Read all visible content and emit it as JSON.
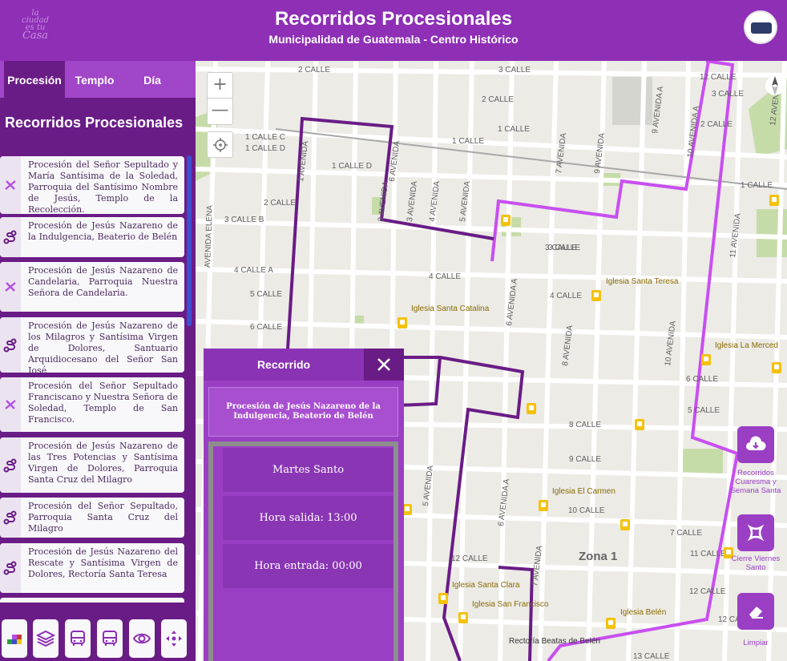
{
  "header": {
    "title": "Recorridos Procesionales",
    "subtitle": "Municipalidad de Guatemala - Centro Histórico",
    "logo_left_text": [
      "la",
      "ciudad",
      "es tu",
      "Casa"
    ]
  },
  "sidebar": {
    "tabs": [
      {
        "label": "Procesión",
        "active": true
      },
      {
        "label": "Templo",
        "active": false
      },
      {
        "label": "Día",
        "active": false
      }
    ],
    "title": "Recorridos Procesionales",
    "items": [
      {
        "icon": "no-route-icon",
        "label": "Procesión del Señor Sepultado y María Santísima de la Soledad, Parroquia del Santísimo Nombre de Jesús, Templo de la Recolección."
      },
      {
        "icon": "route-icon",
        "label": "Procesión de Jesús Nazareno de la Indulgencia, Beaterio de Belén"
      },
      {
        "icon": "no-route-icon",
        "label": "Procesión de Jesús Nazareno de Candelaria, Parroquia Nuestra Señora de Candelaria."
      },
      {
        "icon": "route-icon",
        "label": "Procesión de Jesús Nazareno de los Milagros y Santísima Virgen de Dolores, Santuario Arquidiocesano del Señor San José"
      },
      {
        "icon": "no-route-icon",
        "label": "Procesión del Señor Sepultado Franciscano y Nuestra Señora de Soledad, Templo de San Francisco."
      },
      {
        "icon": "route-icon",
        "label": "Procesión de Jesús Nazareno de las Tres Potencias y Santísima Virgen de Dolores, Parroquia Santa Cruz del Milagro"
      },
      {
        "icon": "route-icon",
        "label": "Procesión del Señor Sepultado, Parroquia Santa Cruz del Milagro"
      },
      {
        "icon": "route-icon",
        "label": "Procesión de Jesús Nazareno del Rescate y Santísima Virgen de Dolores, Rectoría Santa Teresa"
      }
    ]
  },
  "toolbar": {
    "buttons": [
      "legend-icon",
      "layers-icon",
      "bus-icon",
      "bus-alt-icon",
      "eye-icon",
      "move-icon"
    ]
  },
  "map": {
    "streets": [
      "2 CALLE",
      "3 CALLE",
      "2 CALLE",
      "1 CALLE",
      "1 CALLE C",
      "1 CALLE D",
      "1 CALLE D",
      "1 CALLE",
      "2 CALLE",
      "3 CALLE B",
      "3 CALLE",
      "4 CALLE A",
      "4 CALLE",
      "5 CALLE",
      "6 CALLE",
      "4 CALLE",
      "3 CALLE",
      "5 CALLE",
      "8 CALLE",
      "9 CALLE",
      "10 CALLE",
      "12 CALLE",
      "12 CALLE",
      "12 CALLE",
      "1 AVENIDA",
      "3 AVENIDA",
      "3 AVENIDA",
      "4 AVENIDA",
      "5 AVENIDA",
      "6 AVENIDA A",
      "6 AVENIDA",
      "7 AVENIDA",
      "8 AVENIDA",
      "9 AVENIDA A",
      "9 AVENIDA",
      "10 AVENIDA",
      "10 AVENIDA A",
      "11 AVENIDA",
      "12 AVENIDA",
      "AVENIDA ELENA",
      "1 CALLE",
      "3 CALLE",
      "2 CALLE",
      "6 CALLE",
      "7 CALLE",
      "11 CALLE",
      "12 CALLE",
      "13 CALLE",
      "5 AVENIDA",
      "6 AVENIDA A",
      "7 AVENIDA"
    ],
    "pois": [
      "Iglesia Santa Teresa",
      "Iglesia Santa Catalina",
      "Iglesia La Merced",
      "Iglesia El Carmen",
      "Iglesia Santa Clara",
      "Iglesia San Francisco",
      "Iglesia Belén",
      "Rectoría Beatas de Belén"
    ],
    "zone_label": "Zona 1",
    "route_color_active": "#6a1c86",
    "route_color_other": "#c84ff0"
  },
  "map_controls": {
    "zoom_in": "+",
    "zoom_out": "—"
  },
  "right_buttons": [
    {
      "icon": "cloud-download-icon",
      "label": "Recorridos Cuaresma y Semana Santa"
    },
    {
      "icon": "crop-icon",
      "label": "Cierre Viernes Santo"
    },
    {
      "icon": "eraser-icon",
      "label": "Limpiar"
    }
  ],
  "popup": {
    "title": "Recorrido",
    "description": "Procesión de Jesús Nazareno de la Indulgencia, Beaterio de Belén",
    "day": "Martes Santo",
    "departure": "Hora salida: 13:00",
    "arrival": "Hora entrada: 00:00"
  }
}
